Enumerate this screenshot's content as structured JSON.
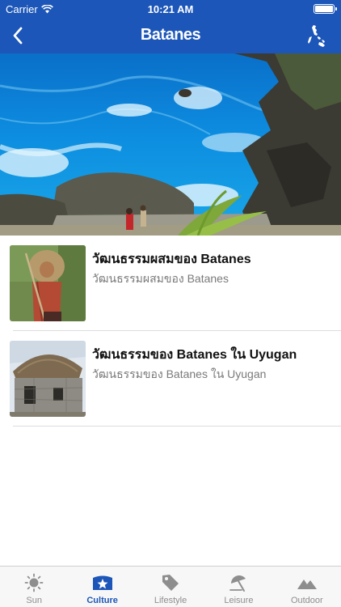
{
  "status_bar": {
    "carrier": "Carrier",
    "time": "10:21 AM"
  },
  "nav": {
    "title": "Batanes",
    "back_icon": "chevron-left-icon",
    "map_icon": "philippines-map-icon"
  },
  "hero": {
    "alt": "Batanes coastline"
  },
  "list": {
    "items": [
      {
        "title": "วัฒนธรรมผสมของ Batanes",
        "subtitle": "วัฒนธรรมผสมของ Batanes",
        "thumb": "ivatan-woman-photo"
      },
      {
        "title": "วัฒนธรรมของ Batanes ใน Uyugan",
        "subtitle": "วัฒนธรรมของ Batanes ใน Uyugan",
        "thumb": "stone-house-photo"
      }
    ]
  },
  "tabs": [
    {
      "label": "Sun",
      "icon": "sun-icon",
      "active": false
    },
    {
      "label": "Culture",
      "icon": "culture-icon",
      "active": true
    },
    {
      "label": "Lifestyle",
      "icon": "tag-icon",
      "active": false
    },
    {
      "label": "Leisure",
      "icon": "umbrella-icon",
      "active": false
    },
    {
      "label": "Outdoor",
      "icon": "mountain-icon",
      "active": false
    }
  ],
  "colors": {
    "brand": "#1c56b8",
    "tab_inactive": "#8e8e8e"
  }
}
